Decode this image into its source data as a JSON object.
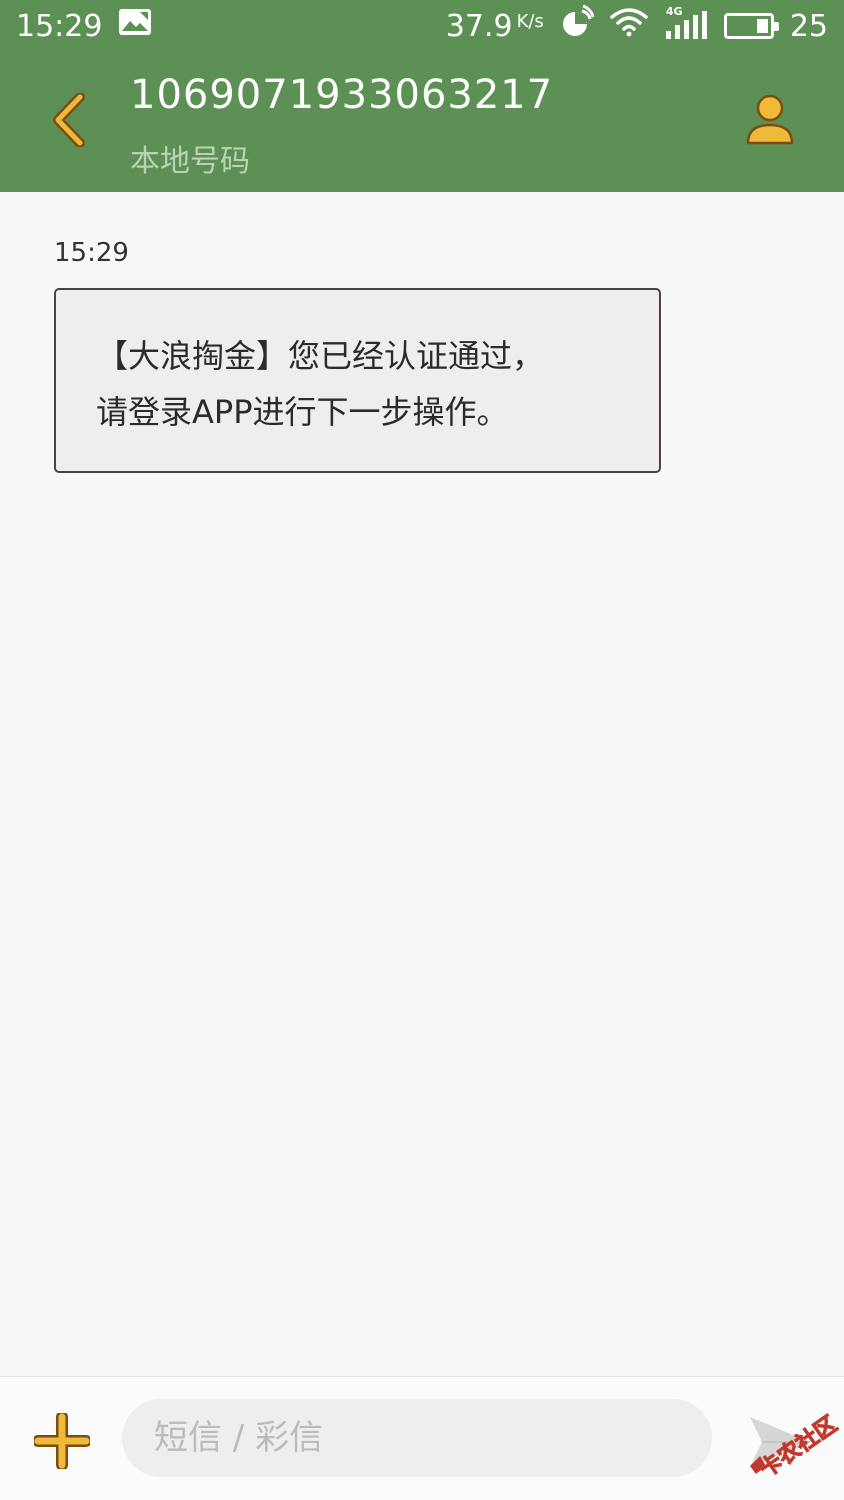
{
  "status_bar": {
    "time": "15:29",
    "network_speed": "37.9",
    "network_speed_unit": "K/s",
    "network_type": "4G",
    "battery_level": "25",
    "battery_fraction": 0.3
  },
  "header": {
    "contact_number": "1069071933063217",
    "contact_subtitle": "本地号码",
    "back_icon": "chevron-left-icon",
    "contact_icon": "person-icon"
  },
  "conversation": {
    "messages": [
      {
        "time": "15:29",
        "line1": "【大浪掏金】您已经认证通过，",
        "line2": "请登录APP进行下一步操作。"
      }
    ]
  },
  "composer": {
    "placeholder": "短信 / 彩信",
    "value": "",
    "add_icon": "plus-icon",
    "send_icon": "send-icon"
  },
  "colors": {
    "header_bg": "#5d9055",
    "icon_gold": "#e8a82c",
    "bubble_bg": "#efeded",
    "bubble_border": "#4a4244"
  }
}
